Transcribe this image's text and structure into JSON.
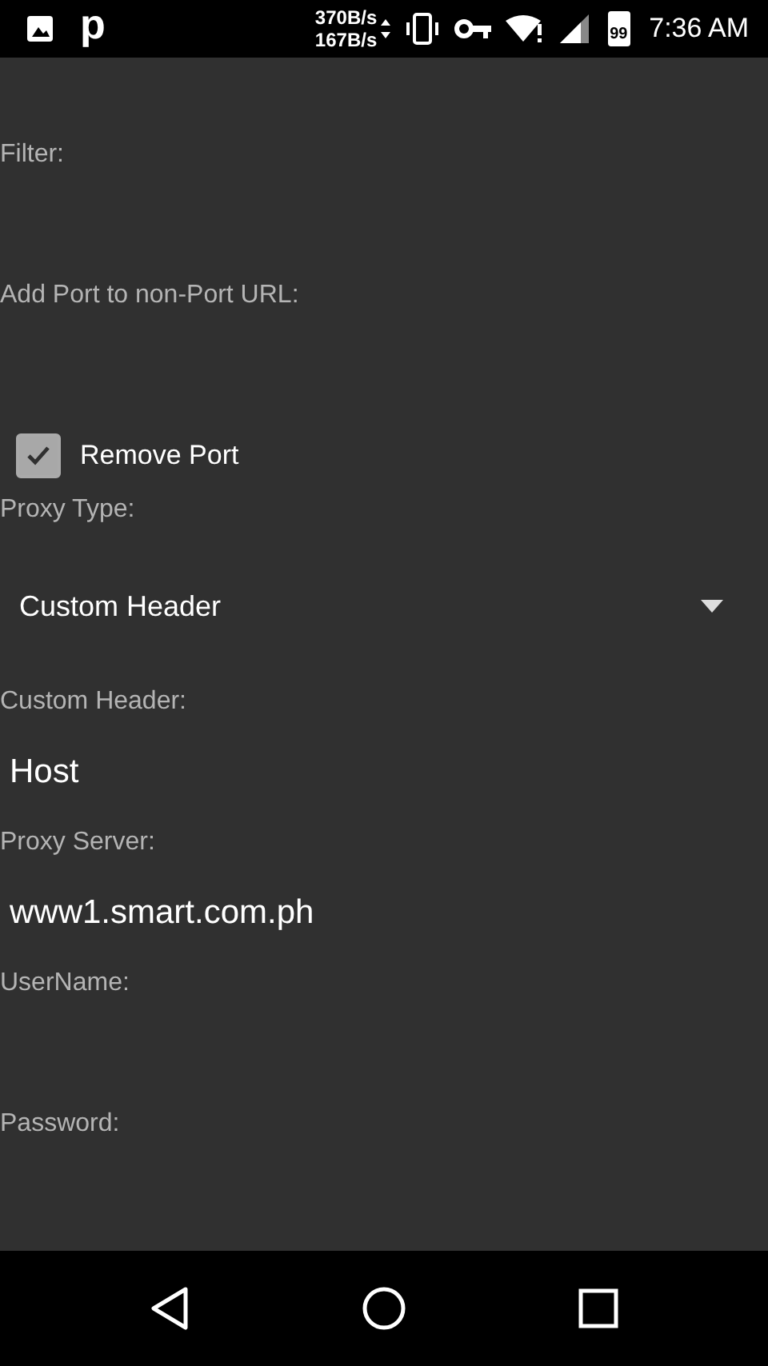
{
  "status_bar": {
    "app_letter": "p",
    "upload_rate": "370B/s",
    "download_rate": "167B/s",
    "battery": "99",
    "time": "7:36 AM"
  },
  "form": [
    {
      "kind": "label",
      "text": "Filter:"
    },
    {
      "kind": "input"
    },
    {
      "kind": "label",
      "text": "Add Port to non-Port URL:"
    },
    {
      "kind": "input"
    },
    {
      "kind": "checkbox",
      "text": "Remove Port",
      "checked": true
    },
    {
      "kind": "label",
      "text": "Proxy Type:"
    },
    {
      "kind": "spinner",
      "value": "Custom Header"
    },
    {
      "kind": "label",
      "text": "Custom Header:"
    },
    {
      "kind": "input",
      "value": "Host"
    },
    {
      "kind": "label",
      "text": "Proxy Server:"
    },
    {
      "kind": "input",
      "value": "www1.smart.com.ph"
    },
    {
      "kind": "label",
      "text": "UserName:"
    },
    {
      "kind": "input"
    },
    {
      "kind": "label",
      "text": "Password:"
    },
    {
      "kind": "input"
    }
  ]
}
